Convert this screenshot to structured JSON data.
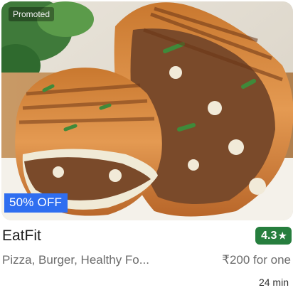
{
  "restaurant": {
    "promoted_label": "Promoted",
    "discount_label": "50% OFF",
    "name": "EatFit",
    "rating": "4.3",
    "rating_icon": "star-icon",
    "cuisines": "Pizza, Burger, Healthy Fo...",
    "price_for_one": "₹200 for one",
    "delivery_time": "24 min",
    "colors": {
      "rating_badge": "#267e3e",
      "discount_badge": "#2f6ef0",
      "muted_text": "#6b6b6b"
    }
  }
}
